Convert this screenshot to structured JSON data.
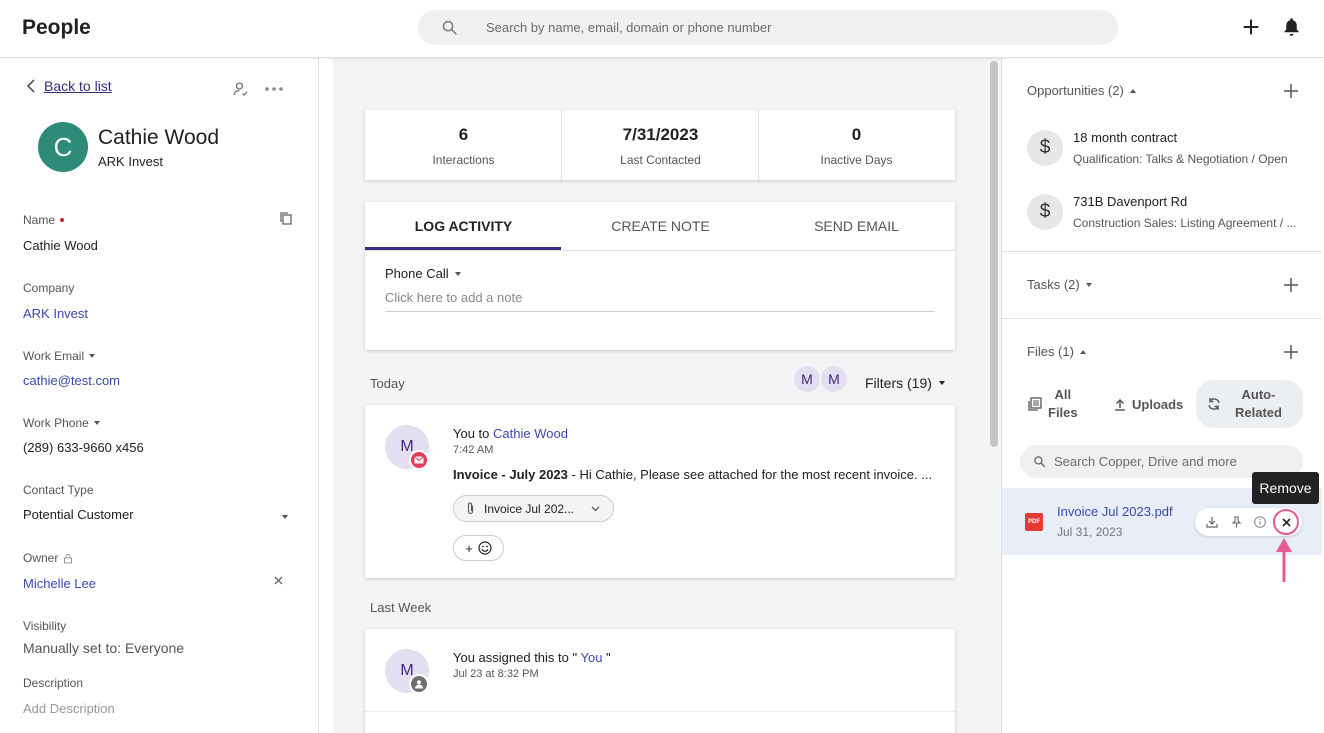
{
  "header": {
    "title": "People",
    "search_placeholder": "Search by name, email, domain or phone number"
  },
  "left": {
    "back_label": "Back to list",
    "avatar_initial": "C",
    "name": "Cathie Wood",
    "company": "ARK Invest",
    "fields": {
      "name_label": "Name",
      "name_value": "Cathie Wood",
      "company_label": "Company",
      "company_value": "ARK Invest",
      "email_label": "Work Email",
      "email_value": "cathie@test.com",
      "phone_label": "Work Phone",
      "phone_value": "(289) 633-9660 x456",
      "contact_type_label": "Contact Type",
      "contact_type_value": "Potential Customer",
      "owner_label": "Owner",
      "owner_value": "Michelle Lee",
      "visibility_label": "Visibility",
      "visibility_value": "Manually set to: Everyone",
      "description_label": "Description",
      "description_placeholder": "Add Description"
    }
  },
  "stats": [
    {
      "value": "6",
      "label": "Interactions"
    },
    {
      "value": "7/31/2023",
      "label": "Last Contacted"
    },
    {
      "value": "0",
      "label": "Inactive Days"
    }
  ],
  "activity_tabs": [
    "LOG ACTIVITY",
    "CREATE NOTE",
    "SEND EMAIL"
  ],
  "log": {
    "type": "Phone Call",
    "note_placeholder": "Click here to add a note"
  },
  "feed": {
    "today_label": "Today",
    "filter_avatars": [
      "M",
      "M"
    ],
    "filters_label": "Filters (19)",
    "last_week_label": "Last Week",
    "items": [
      {
        "avatar": "M",
        "prefix": "You to ",
        "target": "Cathie Wood",
        "time": "7:42 AM",
        "subject": "Invoice - July 2023",
        "body": " - Hi Cathie, Please see attached for the most recent invoice. ...",
        "attachment": "Invoice Jul 202...",
        "reaction_plus": "+"
      },
      {
        "avatar": "M",
        "prefix": "You assigned this to \" ",
        "target": "You",
        "suffix": " \"",
        "time": "Jul 23 at 8:32 PM"
      }
    ]
  },
  "right": {
    "opportunities_label": "Opportunities (2)",
    "opportunities": [
      {
        "icon": "$",
        "title": "18 month contract",
        "subtitle": "Qualification: Talks & Negotiation / Open"
      },
      {
        "icon": "$",
        "title": "731B Davenport Rd",
        "subtitle": "Construction Sales: Listing Agreement / ..."
      }
    ],
    "tasks_label": "Tasks (2)",
    "files_label": "Files (1)",
    "file_tabs": [
      {
        "line1": "All",
        "line2": "Files"
      },
      {
        "line1": "Uploads",
        "line2": ""
      },
      {
        "line1": "Auto-",
        "line2": "Related"
      }
    ],
    "file_search_placeholder": "Search Copper, Drive and more",
    "file": {
      "badge": "PDF",
      "name": "Invoice Jul 2023.pdf",
      "date": "Jul 31, 2023"
    },
    "tooltip": "Remove"
  },
  "colors": {
    "accent": "#3b2a7a",
    "link": "#3949ab",
    "avatar_teal": "#2e8b7a",
    "email_badge": "#e53957",
    "highlight_row": "#e8edf8",
    "arrow_pink": "#e75a96"
  }
}
